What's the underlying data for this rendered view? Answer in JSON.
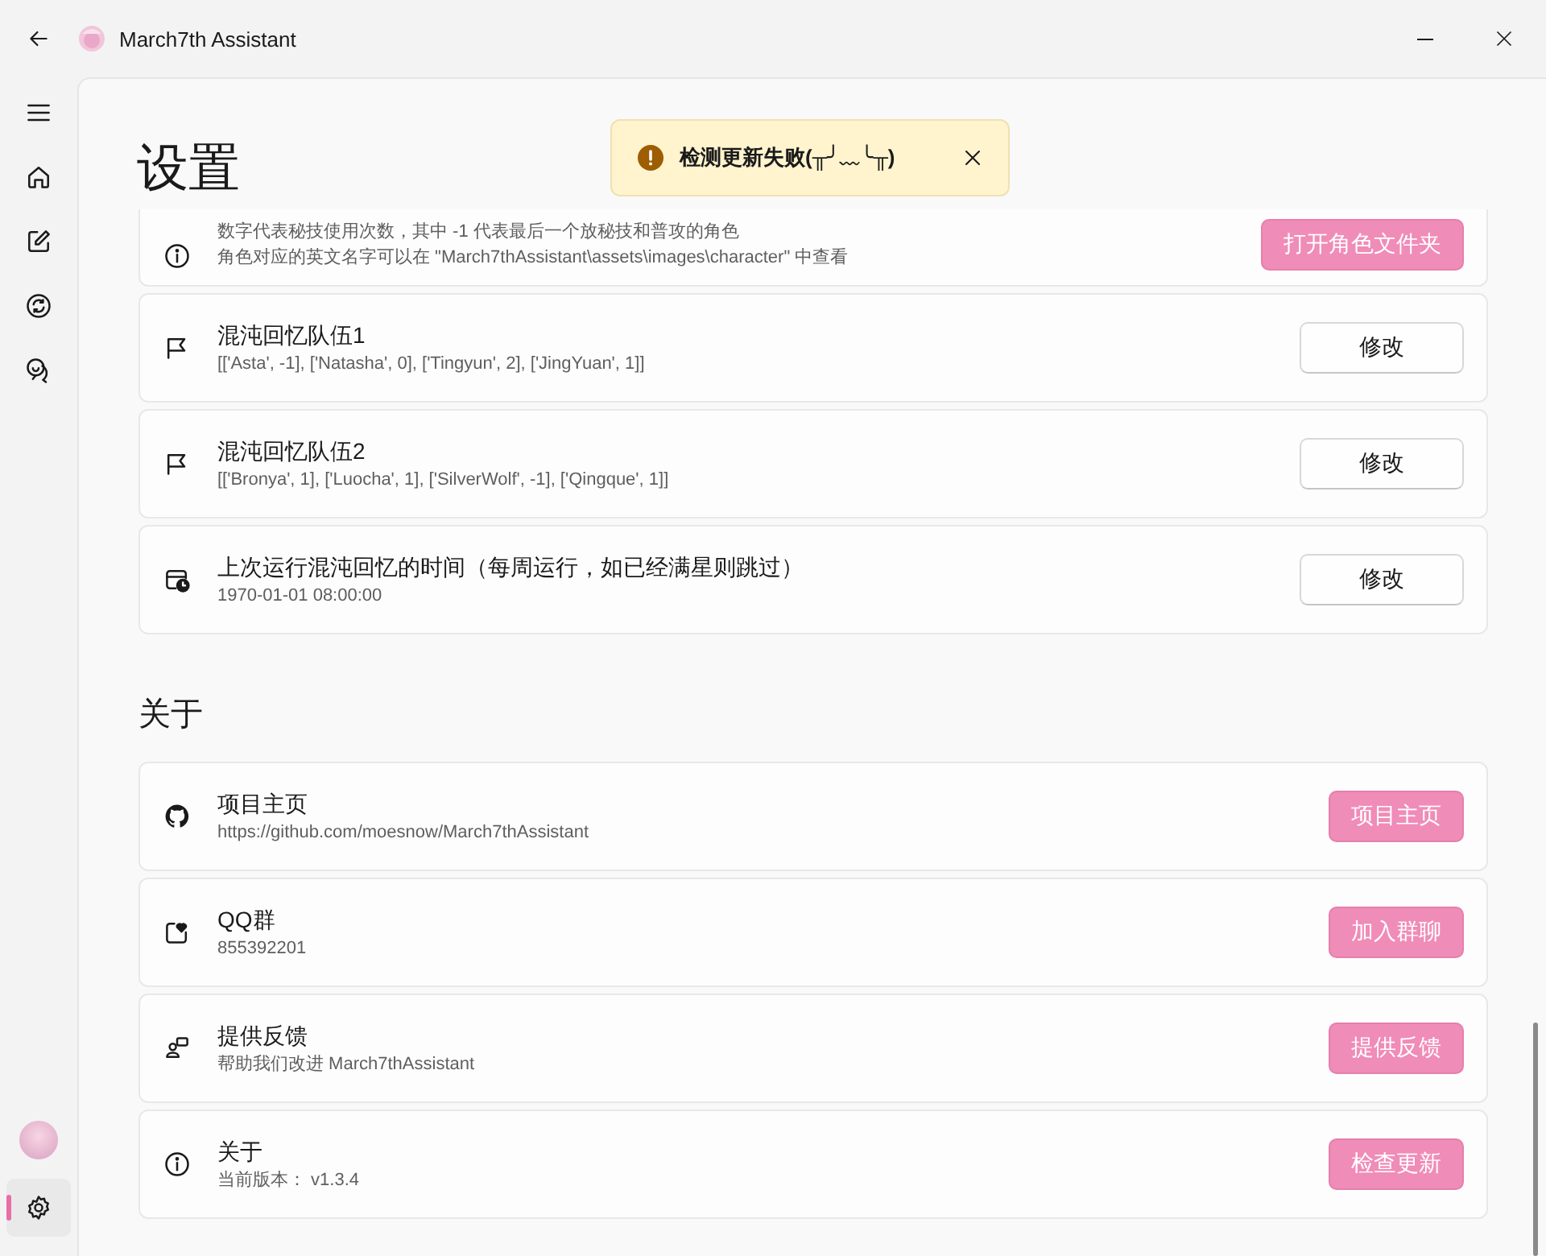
{
  "window": {
    "title": "March7th Assistant"
  },
  "nav_items": [
    {
      "selected": false
    },
    {
      "selected": false
    },
    {
      "selected": false
    },
    {
      "selected": false
    }
  ],
  "bottom_nav": [
    {
      "selected": true
    }
  ],
  "page": {
    "title": "设置"
  },
  "toast": {
    "message": "检测更新失败(╥╯﹏╰╥)"
  },
  "groups": [
    {
      "cards": [
        {
          "lines": [
            "数字代表秘技使用次数，其中 -1 代表最后一个放秘技和普攻的角色",
            "角色对应的英文名字可以在 \"March7thAssistant\\assets\\images\\character\" 中查看"
          ],
          "button": {
            "label": "打开角色文件夹",
            "kind": "primary"
          }
        },
        {
          "title": "混沌回忆队伍1",
          "lines": [
            "[['Asta', -1], ['Natasha', 0], ['Tingyun', 2], ['JingYuan', 1]]"
          ],
          "button": {
            "label": "修改",
            "kind": "standard"
          }
        },
        {
          "title": "混沌回忆队伍2",
          "lines": [
            "[['Bronya', 1], ['Luocha', 1], ['SilverWolf', -1], ['Qingque', 1]]"
          ],
          "button": {
            "label": "修改",
            "kind": "standard"
          }
        },
        {
          "title": "上次运行混沌回忆的时间（每周运行，如已经满星则跳过）",
          "lines": [
            "1970-01-01 08:00:00"
          ],
          "button": {
            "label": "修改",
            "kind": "standard"
          }
        }
      ]
    },
    {
      "title": "关于",
      "cards": [
        {
          "title": "项目主页",
          "lines": [
            "https://github.com/moesnow/March7thAssistant"
          ],
          "button": {
            "label": "项目主页",
            "kind": "primary"
          }
        },
        {
          "title": "QQ群",
          "lines": [
            "855392201"
          ],
          "button": {
            "label": "加入群聊",
            "kind": "primary"
          }
        },
        {
          "title": "提供反馈",
          "lines": [
            "帮助我们改进 March7thAssistant"
          ],
          "button": {
            "label": "提供反馈",
            "kind": "primary"
          }
        },
        {
          "title": "关于",
          "lines": [
            "当前版本： v1.3.4"
          ],
          "button": {
            "label": "检查更新",
            "kind": "primary"
          }
        }
      ]
    }
  ]
}
